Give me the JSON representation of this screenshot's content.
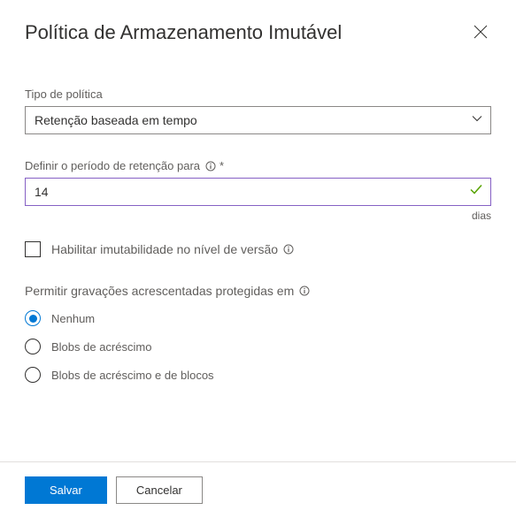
{
  "header": {
    "title": "Política de Armazenamento Imutável"
  },
  "policy_type": {
    "label": "Tipo de política",
    "value": "Retenção baseada em tempo"
  },
  "retention": {
    "label": "Definir o período de retenção para",
    "required": "*",
    "value": "14",
    "unit": "dias"
  },
  "version_checkbox": {
    "label": "Habilitar imutabilidade no nível de versão",
    "checked": false
  },
  "append_group": {
    "label": "Permitir gravações acrescentadas protegidas em",
    "options": [
      {
        "label": "Nenhum",
        "selected": true
      },
      {
        "label": "Blobs de acréscimo",
        "selected": false
      },
      {
        "label": "Blobs de acréscimo e de blocos",
        "selected": false
      }
    ]
  },
  "footer": {
    "save": "Salvar",
    "cancel": "Cancelar"
  }
}
